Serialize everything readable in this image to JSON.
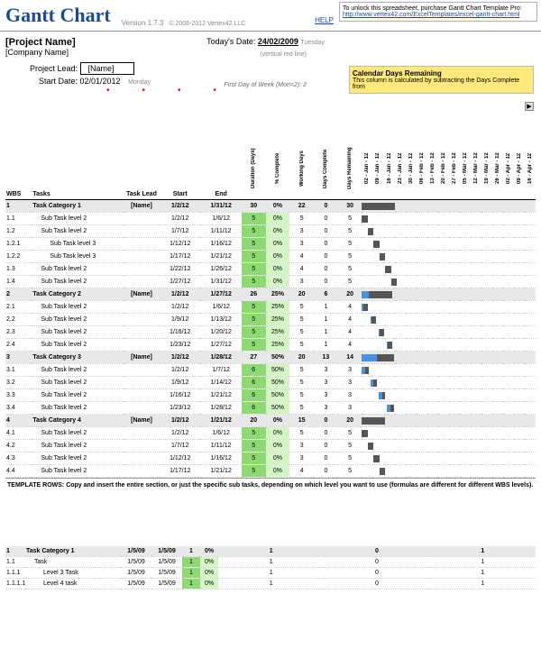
{
  "header": {
    "title": "Gantt Chart",
    "version": "Version 1.7.3",
    "copyright": "© 2006-2012 Vertex42 LLC",
    "help": "HELP",
    "promo_text": "To unlock this spreadsheet, purchase Gantt Chart Template Pro:",
    "promo_link": "http://www.vertex42.com/ExcelTemplates/excel-gantt-chart.html"
  },
  "info": {
    "project_name": "[Project Name]",
    "company_name": "[Company Name]",
    "today_label": "Today's Date:",
    "today_date": "24/02/2009",
    "today_day": "Tuesday",
    "vert_note": "(vertical red line)",
    "lead_label": "Project Lead:",
    "lead_value": "[Name]",
    "start_label": "Start Date:",
    "start_value": "02/01/2012",
    "start_day": "Monday",
    "fdow": "First Day of Week (Mon=2): 2",
    "cal_note_title": "Calendar Days Remaining",
    "cal_note_text": "This column is calculated by subtracting the Days Complete from"
  },
  "cols": {
    "wbs": "WBS",
    "tasks": "Tasks",
    "lead": "Task Lead",
    "start": "Start",
    "end": "End",
    "dur": "Duration (Days)",
    "pct": "% Complete",
    "wd": "Working Days",
    "dc": "Days Complete",
    "dr": "Days Remaining"
  },
  "dates": [
    "02 - Jan - 12",
    "09 - Jan - 12",
    "16 - Jan - 12",
    "23 - Jan - 12",
    "30 - Jan - 12",
    "06 - Feb - 12",
    "13 - Feb - 12",
    "20 - Feb - 12",
    "27 - Feb - 12",
    "05 - Mar - 12",
    "12 - Mar - 12",
    "19 - Mar - 12",
    "26 - Mar - 12",
    "02 - Apr - 12",
    "09 - Apr - 12",
    "16 - Apr - 12"
  ],
  "chart_data": {
    "type": "table",
    "rows": [
      {
        "wbs": "1",
        "task": "Task Category 1",
        "lead": "[Name]",
        "start": "1/2/12",
        "end": "1/31/12",
        "dur": 30,
        "pct": "0%",
        "wd": 22,
        "dc": 0,
        "dr": 30,
        "cat": true,
        "bar": [
          0,
          28
        ],
        "prog": 0
      },
      {
        "wbs": "1.1",
        "task": "Sub Task level 2",
        "lead": "",
        "start": "1/2/12",
        "end": "1/6/12",
        "dur": 5,
        "pct": "0%",
        "wd": 5,
        "dc": 0,
        "dr": 5,
        "lvl": 1,
        "bar": [
          0,
          5
        ],
        "prog": 0
      },
      {
        "wbs": "1.2",
        "task": "Sub Task level 2",
        "lead": "",
        "start": "1/7/12",
        "end": "1/11/12",
        "dur": 5,
        "pct": "0%",
        "wd": 3,
        "dc": 0,
        "dr": 5,
        "lvl": 1,
        "bar": [
          5,
          5
        ],
        "prog": 0
      },
      {
        "wbs": "1.2.1",
        "task": "Sub Task level 3",
        "lead": "",
        "start": "1/12/12",
        "end": "1/16/12",
        "dur": 5,
        "pct": "0%",
        "wd": 3,
        "dc": 0,
        "dr": 5,
        "lvl": 2,
        "bar": [
          10,
          5
        ],
        "prog": 0
      },
      {
        "wbs": "1.2.2",
        "task": "Sub Task level 3",
        "lead": "",
        "start": "1/17/12",
        "end": "1/21/12",
        "dur": 5,
        "pct": "0%",
        "wd": 4,
        "dc": 0,
        "dr": 5,
        "lvl": 2,
        "bar": [
          15,
          5
        ],
        "prog": 0
      },
      {
        "wbs": "1.3",
        "task": "Sub Task level 2",
        "lead": "",
        "start": "1/22/12",
        "end": "1/26/12",
        "dur": 5,
        "pct": "0%",
        "wd": 4,
        "dc": 0,
        "dr": 5,
        "lvl": 1,
        "bar": [
          20,
          5
        ],
        "prog": 0
      },
      {
        "wbs": "1.4",
        "task": "Sub Task level 2",
        "lead": "",
        "start": "1/27/12",
        "end": "1/31/12",
        "dur": 5,
        "pct": "0%",
        "wd": 3,
        "dc": 0,
        "dr": 5,
        "lvl": 1,
        "bar": [
          25,
          5
        ],
        "prog": 0
      },
      {
        "wbs": "2",
        "task": "Task Category 2",
        "lead": "[Name]",
        "start": "1/2/12",
        "end": "1/27/12",
        "dur": 26,
        "pct": "25%",
        "wd": 20,
        "dc": 6,
        "dr": 20,
        "cat": true,
        "bar": [
          0,
          26
        ],
        "prog": 6
      },
      {
        "wbs": "2.1",
        "task": "Sub Task level 2",
        "lead": "",
        "start": "1/2/12",
        "end": "1/6/12",
        "dur": 5,
        "pct": "25%",
        "wd": 5,
        "dc": 1,
        "dr": 4,
        "lvl": 1,
        "bar": [
          0,
          5
        ],
        "prog": 1
      },
      {
        "wbs": "2.2",
        "task": "Sub Task level 2",
        "lead": "",
        "start": "1/9/12",
        "end": "1/13/12",
        "dur": 5,
        "pct": "25%",
        "wd": 5,
        "dc": 1,
        "dr": 4,
        "lvl": 1,
        "bar": [
          7,
          5
        ],
        "prog": 1
      },
      {
        "wbs": "2.3",
        "task": "Sub Task level 2",
        "lead": "",
        "start": "1/16/12",
        "end": "1/20/12",
        "dur": 5,
        "pct": "25%",
        "wd": 5,
        "dc": 1,
        "dr": 4,
        "lvl": 1,
        "bar": [
          14,
          5
        ],
        "prog": 1
      },
      {
        "wbs": "2.4",
        "task": "Sub Task level 2",
        "lead": "",
        "start": "1/23/12",
        "end": "1/27/12",
        "dur": 5,
        "pct": "25%",
        "wd": 5,
        "dc": 1,
        "dr": 4,
        "lvl": 1,
        "bar": [
          21,
          5
        ],
        "prog": 1
      },
      {
        "wbs": "3",
        "task": "Task Category 3",
        "lead": "[Name]",
        "start": "1/2/12",
        "end": "1/28/12",
        "dur": 27,
        "pct": "50%",
        "wd": 20,
        "dc": 13,
        "dr": 14,
        "cat": true,
        "bar": [
          0,
          27
        ],
        "prog": 13
      },
      {
        "wbs": "3.1",
        "task": "Sub Task level 2",
        "lead": "",
        "start": "1/2/12",
        "end": "1/7/12",
        "dur": 6,
        "pct": "50%",
        "wd": 5,
        "dc": 3,
        "dr": 3,
        "lvl": 1,
        "bar": [
          0,
          6
        ],
        "prog": 3
      },
      {
        "wbs": "3.2",
        "task": "Sub Task level 2",
        "lead": "",
        "start": "1/9/12",
        "end": "1/14/12",
        "dur": 6,
        "pct": "50%",
        "wd": 5,
        "dc": 3,
        "dr": 3,
        "lvl": 1,
        "bar": [
          7,
          6
        ],
        "prog": 3
      },
      {
        "wbs": "3.3",
        "task": "Sub Task level 2",
        "lead": "",
        "start": "1/16/12",
        "end": "1/21/12",
        "dur": 6,
        "pct": "50%",
        "wd": 5,
        "dc": 3,
        "dr": 3,
        "lvl": 1,
        "bar": [
          14,
          6
        ],
        "prog": 3
      },
      {
        "wbs": "3.4",
        "task": "Sub Task level 2",
        "lead": "",
        "start": "1/23/12",
        "end": "1/28/12",
        "dur": 6,
        "pct": "50%",
        "wd": 5,
        "dc": 3,
        "dr": 3,
        "lvl": 1,
        "bar": [
          21,
          6
        ],
        "prog": 3
      },
      {
        "wbs": "4",
        "task": "Task Category 4",
        "lead": "[Name]",
        "start": "1/2/12",
        "end": "1/21/12",
        "dur": 20,
        "pct": "0%",
        "wd": 15,
        "dc": 0,
        "dr": 20,
        "cat": true,
        "bar": [
          0,
          20
        ],
        "prog": 0
      },
      {
        "wbs": "4.1",
        "task": "Sub Task level 2",
        "lead": "",
        "start": "1/2/12",
        "end": "1/6/12",
        "dur": 5,
        "pct": "0%",
        "wd": 5,
        "dc": 0,
        "dr": 5,
        "lvl": 1,
        "bar": [
          0,
          5
        ],
        "prog": 0
      },
      {
        "wbs": "4.2",
        "task": "Sub Task level 2",
        "lead": "",
        "start": "1/7/12",
        "end": "1/11/12",
        "dur": 5,
        "pct": "0%",
        "wd": 3,
        "dc": 0,
        "dr": 5,
        "lvl": 1,
        "bar": [
          5,
          5
        ],
        "prog": 0
      },
      {
        "wbs": "4.3",
        "task": "Sub Task level 2",
        "lead": "",
        "start": "1/12/12",
        "end": "1/16/12",
        "dur": 5,
        "pct": "0%",
        "wd": 3,
        "dc": 0,
        "dr": 5,
        "lvl": 1,
        "bar": [
          10,
          5
        ],
        "prog": 0
      },
      {
        "wbs": "4.4",
        "task": "Sub Task level 2",
        "lead": "",
        "start": "1/17/12",
        "end": "1/21/12",
        "dur": 5,
        "pct": "0%",
        "wd": 4,
        "dc": 0,
        "dr": 5,
        "lvl": 1,
        "bar": [
          15,
          5
        ],
        "prog": 0
      }
    ],
    "template_note": "TEMPLATE ROWS: Copy and insert the entire section, or just the specific sub tasks, depending on which level you want to use (formulas are different for different WBS levels).",
    "template_rows": [
      {
        "wbs": "1",
        "task": "Task Category 1",
        "start": "1/5/09",
        "end": "1/5/09",
        "dur": 1,
        "pct": "0%",
        "wd": 1,
        "dc": 0,
        "dr": 1,
        "cat": true
      },
      {
        "wbs": "1.1",
        "task": "Task",
        "start": "1/5/09",
        "end": "1/5/09",
        "dur": 1,
        "pct": "0%",
        "wd": 1,
        "dc": 0,
        "dr": 1,
        "lvl": 1
      },
      {
        "wbs": "1.1.1",
        "task": "Level 3 Task",
        "start": "1/5/09",
        "end": "1/5/09",
        "dur": 1,
        "pct": "0%",
        "wd": 1,
        "dc": 0,
        "dr": 1,
        "lvl": 2
      },
      {
        "wbs": "1.1.1.1",
        "task": "Level 4 task",
        "start": "1/5/09",
        "end": "1/5/09",
        "dur": 1,
        "pct": "0%",
        "wd": 1,
        "dc": 0,
        "dr": 1,
        "lvl": 2
      }
    ]
  }
}
